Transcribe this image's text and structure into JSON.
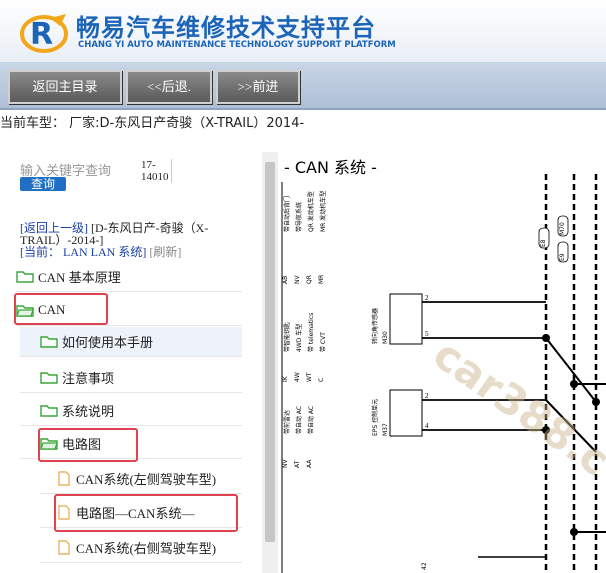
{
  "header": {
    "title": "畅易汽车维修技术支持平台",
    "subtitle": "CHANG YI AUTO MAINTENANCE TECHNOLOGY SUPPORT PLATFORM"
  },
  "nav": {
    "home": "返回主目录",
    "back": "<<后退.",
    "forward": ">>前进"
  },
  "car_line": "当前车型： 厂家:D-东风日产奇骏（X-TRAIL）2014-",
  "search": {
    "placeholder": "输入关键字查询",
    "button": "查询",
    "code": "17-14010"
  },
  "info": {
    "back_link": "[返回上一级]",
    "vehicle": "[D-东风日产-奇骏（X-TRAIL）-2014-]",
    "current_label": "[当前：",
    "current_value": "LAN LAN 系统]",
    "refresh": "[刷新]"
  },
  "tree": [
    {
      "label": "CAN 基本原理"
    },
    {
      "label": "CAN"
    },
    {
      "label": "如何使用本手册"
    },
    {
      "label": "注意事项"
    },
    {
      "label": "系统说明"
    },
    {
      "label": "电路图"
    },
    {
      "label": "CAN系统(左侧驾驶车型)"
    },
    {
      "label": "电路图—CAN系统—"
    },
    {
      "label": "CAN系统(右侧驾驶车型)"
    }
  ],
  "diagram": {
    "title": "- CAN 系统 -",
    "watermark": "car388.c",
    "labels_top": [
      "带自动后背门",
      "带导航系统",
      "QR 发动机车型",
      "MR 发动机车型"
    ],
    "codes_top": [
      "AB",
      "NV",
      "QR",
      "MR"
    ],
    "labels_mid": [
      "带智能钥匙",
      "4WD 车型",
      "带 telematics",
      "带 CVT"
    ],
    "codes_mid": [
      "IK",
      "4W",
      "WT",
      "C"
    ],
    "labels_low": [
      "带前雷达",
      "带自动 AC",
      "带自动 AC"
    ],
    "codes_low": [
      "NV",
      "AT",
      "AA"
    ],
    "module_1": "转向角传感器",
    "module_1_code": "M30",
    "module_2": "EPS 控制单元",
    "module_2_code": "M37",
    "top_codes": [
      "E8",
      "M70",
      "E9"
    ],
    "bottom_code": "42"
  },
  "colors": {
    "brand_blue": "#1b64b8",
    "highlight_red": "#e0424f",
    "folder_green": "#3aa63a"
  }
}
